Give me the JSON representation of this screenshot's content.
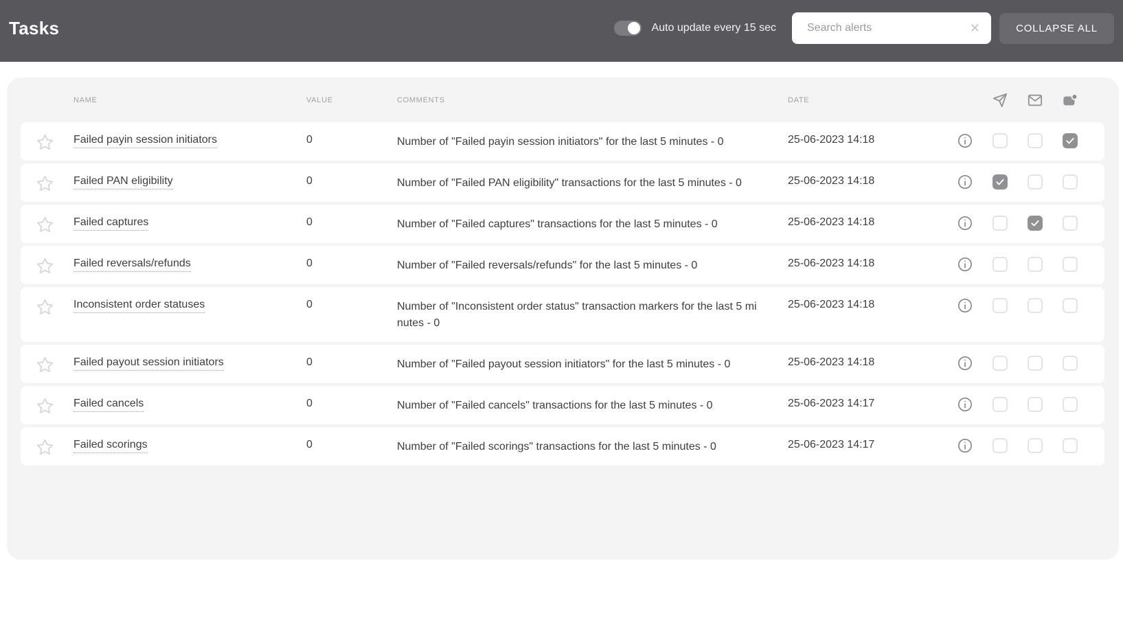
{
  "header": {
    "title": "Tasks",
    "auto_update_label": "Auto update every 15 sec",
    "auto_update_on": true,
    "search_placeholder": "Search alerts",
    "clear_search_glyph": "✕",
    "collapse_all_label": "COLLAPSE ALL"
  },
  "table": {
    "columns": {
      "name": "NAME",
      "value": "VALUE",
      "comments": "COMMENTS",
      "date": "DATE"
    },
    "icon_columns": [
      "telegram-send-icon",
      "mail-icon",
      "push-notification-icon"
    ],
    "rows": [
      {
        "name": "Failed payin session initiators",
        "value": "0",
        "comment": "Number of \"Failed payin session initiators\" for the last 5 minutes - 0",
        "date": "25-06-2023 14:18",
        "notifications": {
          "telegram": false,
          "mail": false,
          "push": true
        }
      },
      {
        "name": "Failed PAN eligibility",
        "value": "0",
        "comment": "Number of \"Failed PAN eligibility\" transactions for the last 5 minutes - 0",
        "date": "25-06-2023 14:18",
        "notifications": {
          "telegram": true,
          "mail": false,
          "push": false
        }
      },
      {
        "name": "Failed captures",
        "value": "0",
        "comment": "Number of \"Failed captures\" transactions for the last 5 minutes - 0",
        "date": "25-06-2023 14:18",
        "notifications": {
          "telegram": false,
          "mail": true,
          "push": false
        }
      },
      {
        "name": "Failed reversals/refunds",
        "value": "0",
        "comment": "Number of \"Failed reversals/refunds\" for the last 5 minutes - 0",
        "date": "25-06-2023 14:18",
        "notifications": {
          "telegram": false,
          "mail": false,
          "push": false
        }
      },
      {
        "name": "Inconsistent order statuses",
        "value": "0",
        "comment": "Number of \"Inconsistent order status\" transaction markers for the last 5 minutes - 0",
        "date": "25-06-2023 14:18",
        "notifications": {
          "telegram": false,
          "mail": false,
          "push": false
        }
      },
      {
        "name": "Failed payout session initiators",
        "value": "0",
        "comment": "Number of \"Failed payout session initiators\" for the last 5 minutes - 0",
        "date": "25-06-2023 14:18",
        "notifications": {
          "telegram": false,
          "mail": false,
          "push": false
        }
      },
      {
        "name": "Failed cancels",
        "value": "0",
        "comment": "Number of \"Failed cancels\" transactions for the last 5 minutes - 0",
        "date": "25-06-2023 14:17",
        "notifications": {
          "telegram": false,
          "mail": false,
          "push": false
        }
      },
      {
        "name": "Failed scorings",
        "value": "0",
        "comment": "Number of \"Failed scorings\" transactions for the last 5 minutes - 0",
        "date": "25-06-2023 14:17",
        "notifications": {
          "telegram": false,
          "mail": false,
          "push": false
        }
      }
    ]
  },
  "colors": {
    "header_bg": "#58585c",
    "card_bg": "#f4f4f4",
    "row_bg": "#ffffff",
    "text": "#3e3e40",
    "muted_label": "#a2a2a2",
    "checkbox_checked": "#919193",
    "button_bg": "#6a6a6e"
  }
}
